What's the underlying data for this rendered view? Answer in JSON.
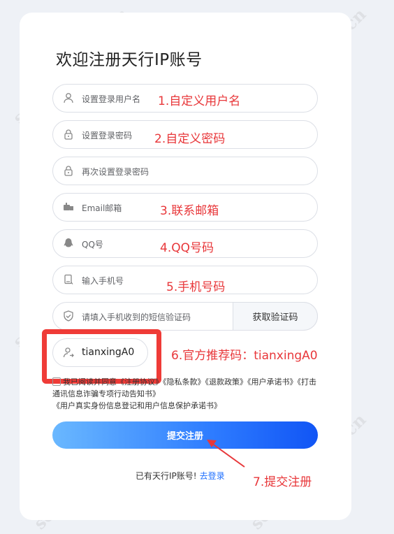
{
  "title": "欢迎注册天行IP账号",
  "fields": [
    {
      "placeholder": "设置登录用户名",
      "icon": "user-icon",
      "annotation": "1.自定义用户名"
    },
    {
      "placeholder": "设置登录密码",
      "icon": "lock-icon",
      "annotation": "2.自定义密码"
    },
    {
      "placeholder": "再次设置登录密码",
      "icon": "lock-icon",
      "annotation": ""
    },
    {
      "placeholder": "Email邮箱",
      "icon": "mailbox-icon",
      "annotation": "3.联系邮箱"
    },
    {
      "placeholder": "QQ号",
      "icon": "qq-penguin-icon",
      "annotation": "4.QQ号码"
    },
    {
      "placeholder": "输入手机号",
      "icon": "phone-icon",
      "annotation": "5.手机号码"
    },
    {
      "placeholder": "请填入手机收到的短信验证码",
      "icon": "shield-check-icon",
      "annotation": ""
    }
  ],
  "get_code_label": "获取验证码",
  "referral": {
    "value": "tianxingA0",
    "icon": "user-arrow-icon",
    "annotation": "6.官方推荐码：tianxingA0"
  },
  "agreement": {
    "prefix": "我已阅读并同意",
    "links": [
      "《注册协议》",
      "《隐私条款》",
      "《退款政策》",
      "《用户承诺书》",
      "《打击通讯信息诈骗专项行动告知书》",
      "《用户真实身份信息登记和用户信息保护承诺书》"
    ]
  },
  "submit_label": "提交注册",
  "submit_annotation": "7.提交注册",
  "login": {
    "text": "已有天行IP账号!",
    "link": "去登录"
  },
  "watermark": "socks5ip.com.cn",
  "colors": {
    "accent": "#1e6fff",
    "annotation": "#e8373a",
    "highlight_box": "#ef3b37"
  }
}
